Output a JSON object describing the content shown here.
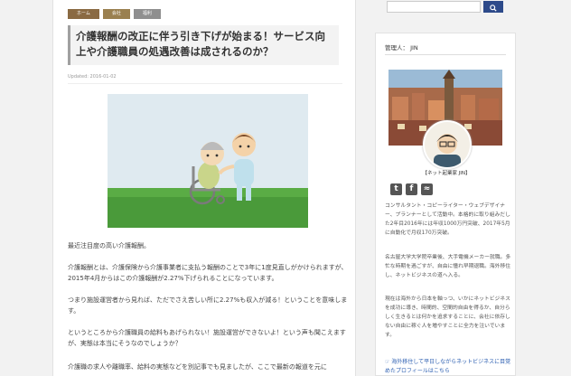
{
  "breadcrumbs": [
    "ホーム",
    "会社",
    "福利"
  ],
  "article": {
    "title": "介護報酬の改正に伴う引き下げが始まる！サービス向上や介護職員の処遇改善は成されるのか？",
    "updated": "Updated: 2016-01-02",
    "paragraphs": [
      "最近注目度の高い介護報酬。",
      "介護報酬とは、介護保険から介護事業者に支払う報酬のことで3年に1度見直しがかけられますが、2015年4月からはこの介護報酬が2.27%下げられることになっています。",
      "つまり施設運営者から見れば、ただでさえ苦しい所に2.27%も収入が減る！ということを意味します。",
      "というところから介護職員の給料もあげられない！施設運営ができないよ！という声も聞こえますが、実態は本当にそうなのでしょうか？",
      "介護職の求人や離職率、給料の実態などを別記事でも見ましたが、ここで最新の報道を元に"
    ]
  },
  "search": {
    "placeholder": ""
  },
  "sidebar": {
    "admin_label": "管理人： JIN",
    "profile_name": "【ネット起業家 JIN】",
    "bio": [
      "コンサルタント・コピーライター・ウェブデザイナー、プランナーとして活動中。本格的に取り組みだした2年目2016年には年収1000万円突破、2017年5月に自動化で月収170万突破。",
      "名古屋大学大学院卒業後、大手電機メーカー就職。多忙な時期を過ごすが、自由に憧れ早期退職。海外移住し、ネットビジネスの道へ入る。",
      "現在は海外から日本を軸っつ、いかにネットビジネスを成功に導き、時間的、空間的自由を得るか、自分らしく生きるとは何かを追求することに、会社に依存しない自由に稼ぐ人を増やすことに全力を注いでいます。"
    ],
    "link": "海外移住して平日しながらネットビジネスに目覚めたプロフィールはこちら"
  },
  "icons": [
    "search-icon",
    "twitter-icon",
    "facebook-icon",
    "rss-icon",
    "link-icon"
  ]
}
